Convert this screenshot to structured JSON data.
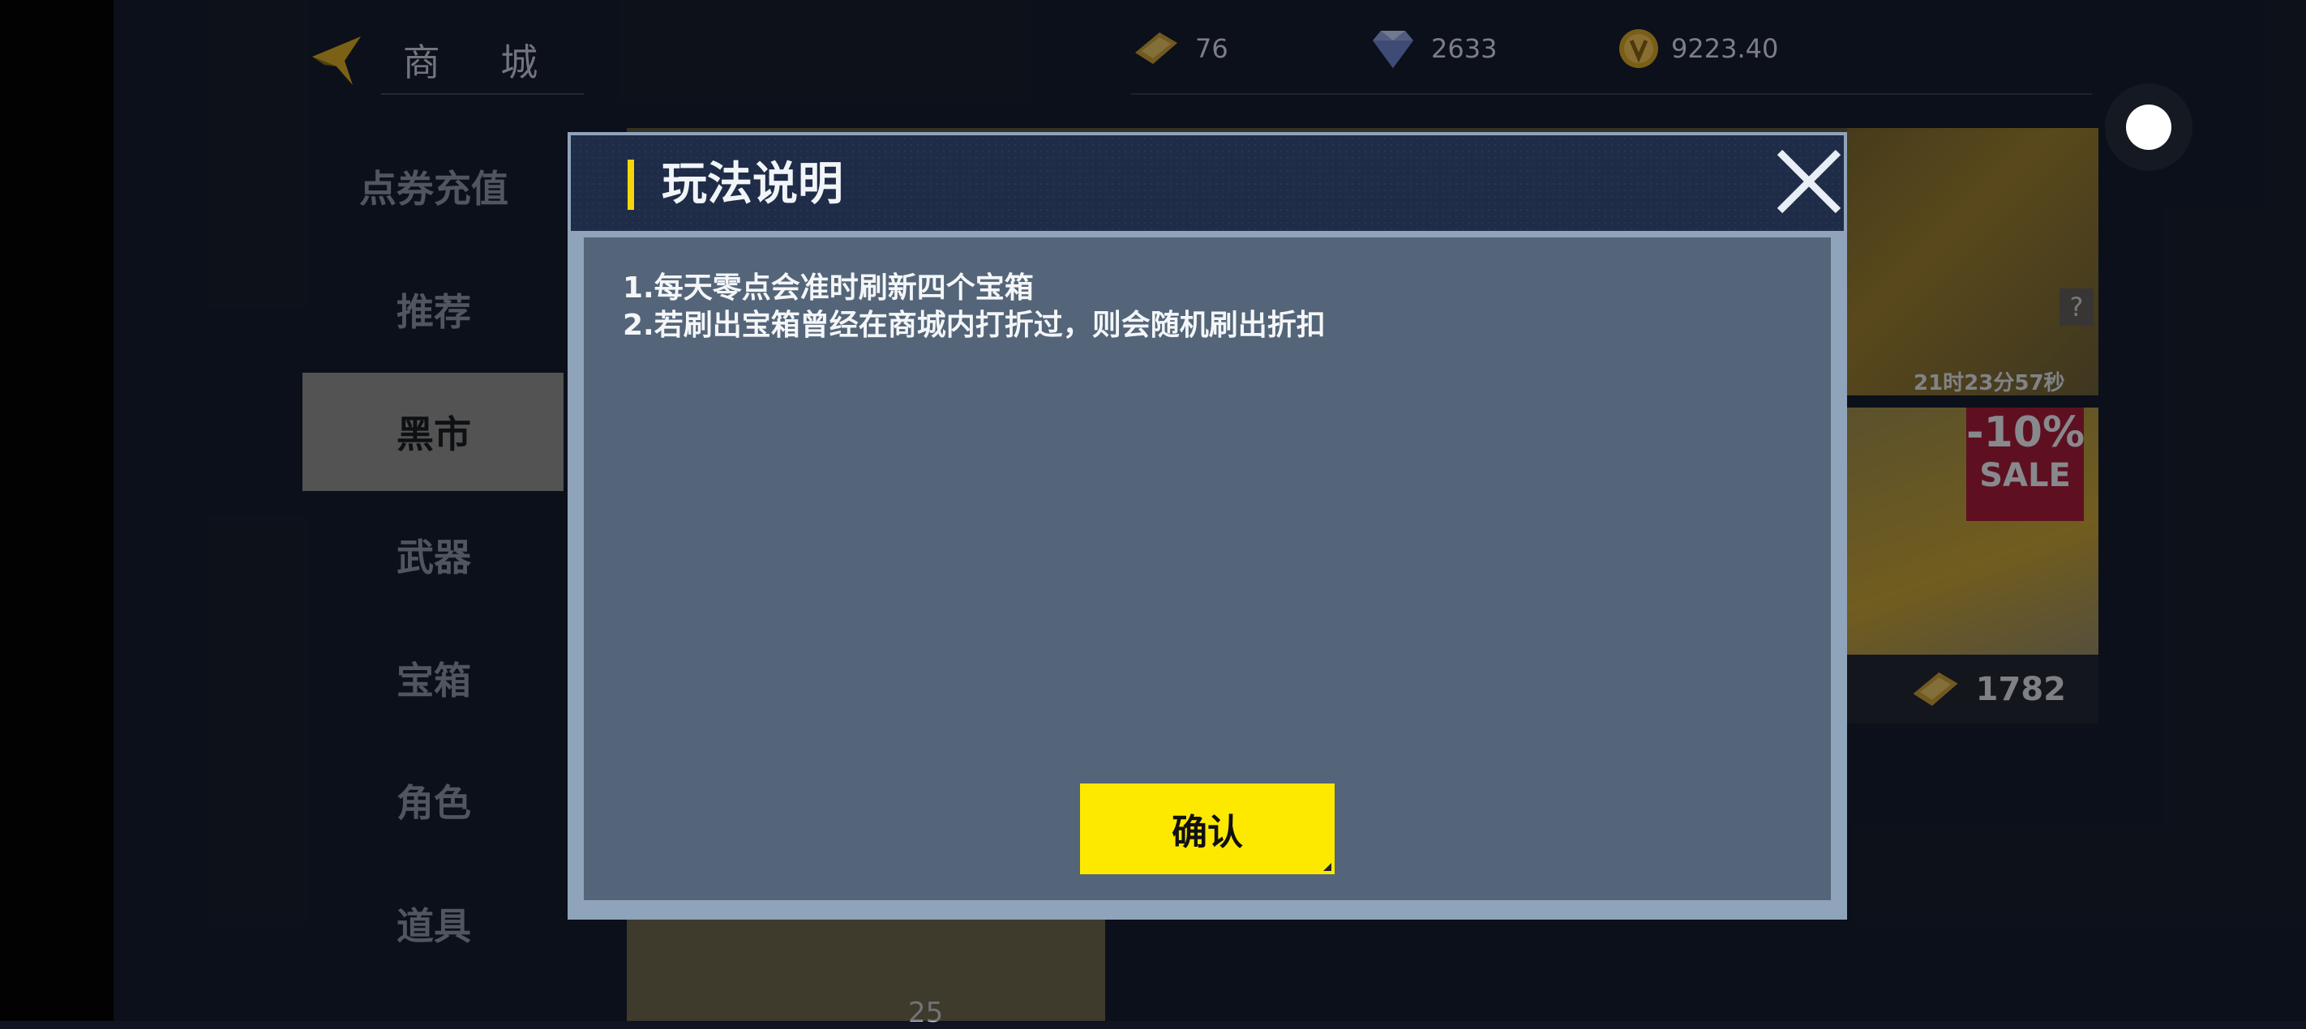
{
  "header": {
    "title": "商 城",
    "currencies": {
      "ticket": "76",
      "diamond": "2633",
      "coin": "9223.40"
    }
  },
  "sidebar": {
    "items": [
      {
        "label": "点券充值"
      },
      {
        "label": "推荐"
      },
      {
        "label": "黑市"
      },
      {
        "label": "武器"
      },
      {
        "label": "宝箱"
      },
      {
        "label": "角色"
      },
      {
        "label": "道具"
      }
    ],
    "active_index": 2
  },
  "background": {
    "timer": "21时23分57秒",
    "help": "?",
    "sale_pct": "-10%",
    "sale_word": "SALE",
    "right_card_price": "1782",
    "bottom_card_price": "25"
  },
  "modal": {
    "title": "玩法说明",
    "rules": [
      "1.每天零点会准时刷新四个宝箱",
      "2.若刷出宝箱曾经在商城内打折过，则会随机刷出折扣"
    ],
    "confirm_label": "确认"
  },
  "colors": {
    "accent_yellow": "#fde900",
    "modal_body": "#546579",
    "modal_header": "#1f2c48",
    "sale_red": "#a5142c"
  }
}
